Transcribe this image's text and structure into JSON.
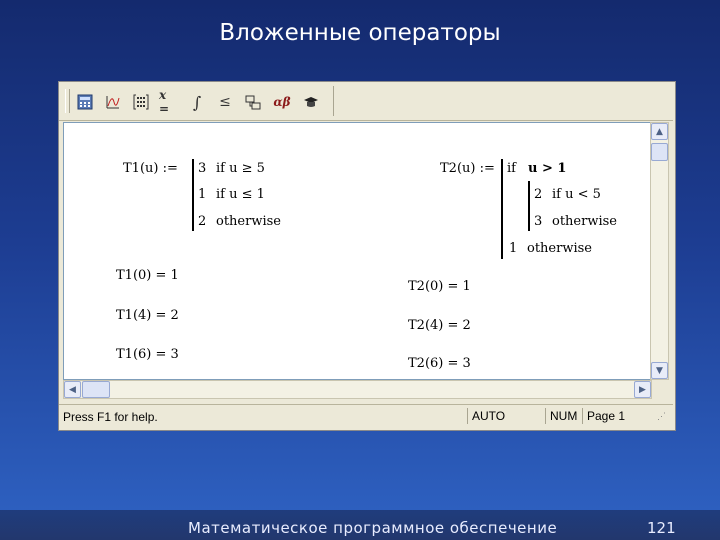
{
  "slide": {
    "title": "Вложенные операторы",
    "footer": "Математическое программное обеспечение",
    "page_number": "121"
  },
  "toolbar": {
    "buttons": [
      {
        "name": "calculator-icon",
        "label": ""
      },
      {
        "name": "graph-icon",
        "label": ""
      },
      {
        "name": "matrix-icon",
        "label": ""
      },
      {
        "name": "evaluation-icon",
        "label": "x ="
      },
      {
        "name": "calculus-icon",
        "label": "∫"
      },
      {
        "name": "boolean-icon",
        "label": "≤"
      },
      {
        "name": "programming-icon",
        "label": ""
      },
      {
        "name": "greek-icon",
        "label": "αβ"
      },
      {
        "name": "symbolic-icon",
        "label": ""
      }
    ]
  },
  "worksheet": {
    "t1": {
      "name": "T1(u) :=",
      "branches": [
        {
          "value": "3",
          "cond": "if  u ≥ 5"
        },
        {
          "value": "1",
          "cond": "if  u ≤ 1"
        },
        {
          "value": "2",
          "cond": "otherwise"
        }
      ],
      "results": [
        "T1(0) = 1",
        "T1(4) = 2",
        "T1(6) = 3"
      ]
    },
    "t2": {
      "name": "T2(u) :=",
      "outer_cond_if": "if",
      "outer_cond": "u > 1",
      "inner_branches": [
        {
          "value": "2",
          "cond": "if  u < 5"
        },
        {
          "value": "3",
          "cond": "otherwise"
        }
      ],
      "outer_otherwise_value": "1",
      "outer_otherwise": "otherwise",
      "results": [
        "T2(0) = 1",
        "T2(4) = 2",
        "T2(6) = 3"
      ]
    }
  },
  "status": {
    "help": "Press F1 for help.",
    "mode": "AUTO",
    "num": "NUM",
    "page": "Page 1"
  }
}
